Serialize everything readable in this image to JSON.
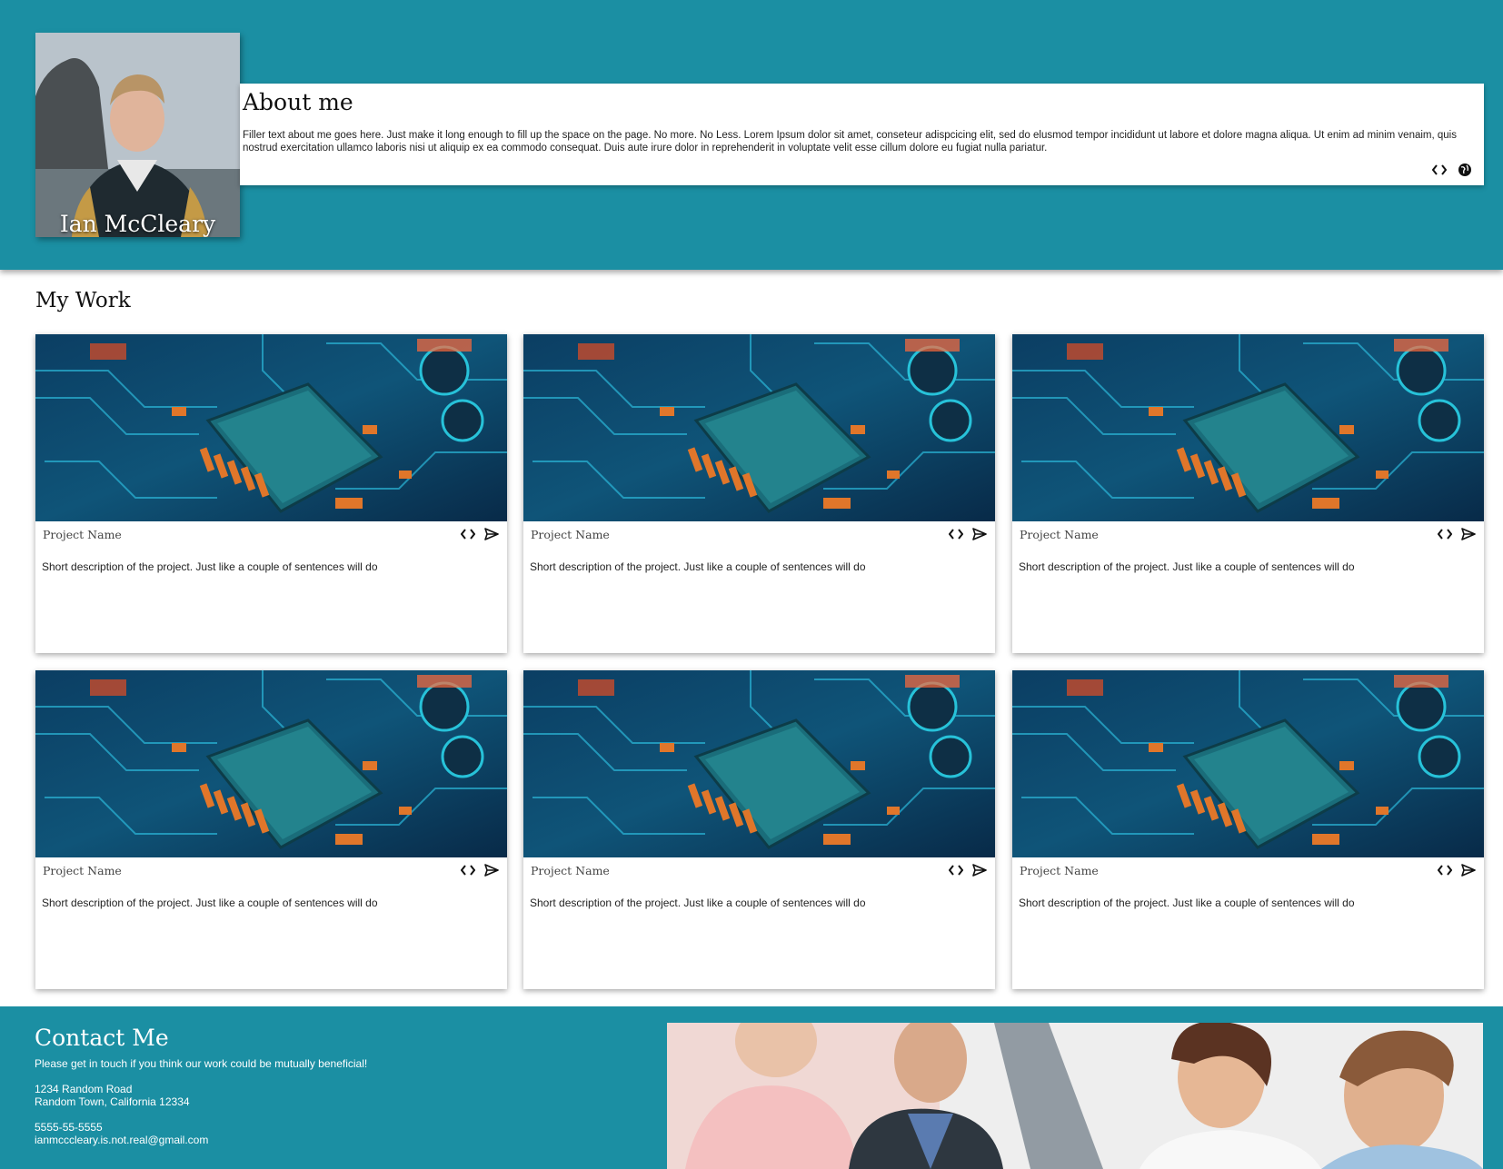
{
  "header": {
    "name": "Ian McCleary",
    "about_title": "About me",
    "about_text": "Filler text about me goes here. Just make it long enough to fill up the space on the page. No more. No Less. Lorem Ipsum dolor sit amet, conseteur adispcicing elit, sed do elusmod tempor incididunt ut labore et dolore magna aliqua. Ut enim ad minim venaim, quis nostrud exercitation ullamco laboris nisi ut aliquip ex ea commodo consequat. Duis aute irure dolor in reprehenderit in voluptate velit esse cillum dolore eu fugiat nulla pariatur.",
    "icons": [
      "code-icon",
      "globe-icon"
    ]
  },
  "work": {
    "title": "My Work",
    "projects": [
      {
        "name": "Project Name",
        "description": "Short description of the project. Just like a couple of sentences will do"
      },
      {
        "name": "Project Name",
        "description": "Short description of the project. Just like a couple of sentences will do"
      },
      {
        "name": "Project Name",
        "description": "Short description of the project. Just like a couple of sentences will do"
      },
      {
        "name": "Project Name",
        "description": "Short description of the project. Just like a couple of sentences will do"
      },
      {
        "name": "Project Name",
        "description": "Short description of the project. Just like a couple of sentences will do"
      },
      {
        "name": "Project Name",
        "description": "Short description of the project. Just like a couple of sentences will do"
      }
    ],
    "card_icons": [
      "code-icon",
      "send-icon"
    ]
  },
  "contact": {
    "title": "Contact Me",
    "subtitle": "Please get in touch if you think our work could be mutually beneficial!",
    "address_line1": "1234 Random Road",
    "address_line2": "Random Town, California 12334",
    "phone": "5555-55-5555",
    "email": "ianmcccleary.is.not.real@gmail.com"
  },
  "colors": {
    "brand": "#1b8fa3",
    "card_bg": "#ffffff"
  }
}
